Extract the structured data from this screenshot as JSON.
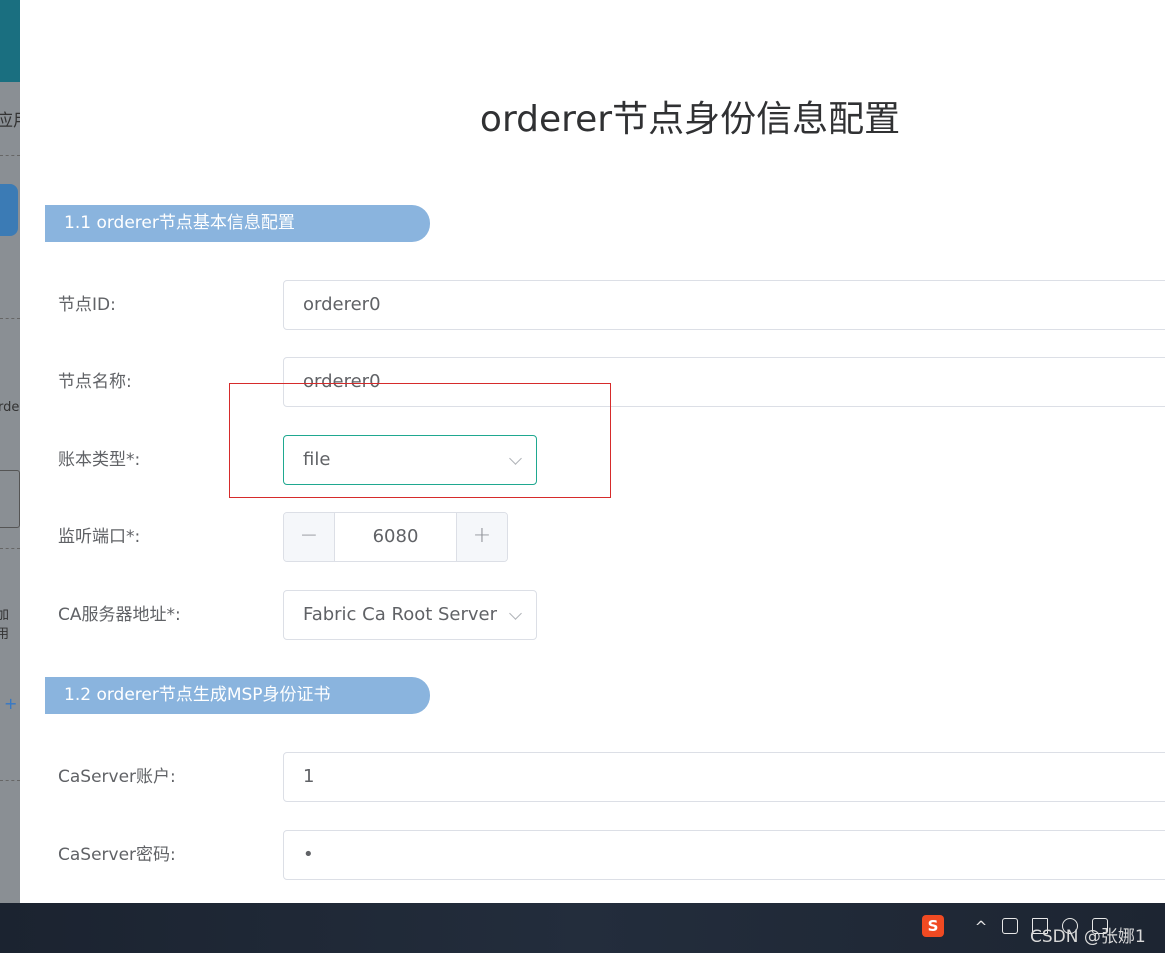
{
  "background_app": {
    "label_top": "应用",
    "label_mid": "rde",
    "label_low": "加用",
    "plus": "+"
  },
  "page_title": "orderer节点身份信息配置",
  "section1": {
    "title": "1.1 orderer节点基本信息配置",
    "node_id": {
      "label": "节点ID:",
      "value": "orderer0"
    },
    "node_name": {
      "label": "节点名称:",
      "value": "orderer0"
    },
    "ledger_type": {
      "label": "账本类型*:",
      "value": "file"
    },
    "listen_port": {
      "label": "监听端口*:",
      "value": "6080",
      "minus": "−",
      "plus": "+"
    },
    "ca_server": {
      "label": "CA服务器地址*:",
      "value": "Fabric Ca Root Server"
    }
  },
  "section2": {
    "title": "1.2 orderer节点生成MSP身份证书",
    "ca_account": {
      "label": "CaServer账户:",
      "value": "1"
    },
    "ca_password": {
      "label": "CaServer密码:",
      "value": "•"
    }
  },
  "taskbar": {
    "ime_label": "S",
    "caret": "^",
    "watermark": "CSDN @张娜1"
  },
  "colors": {
    "section_bg": "#8ab4de",
    "active_border": "#1fa890",
    "highlight_box": "#d62b2b"
  }
}
